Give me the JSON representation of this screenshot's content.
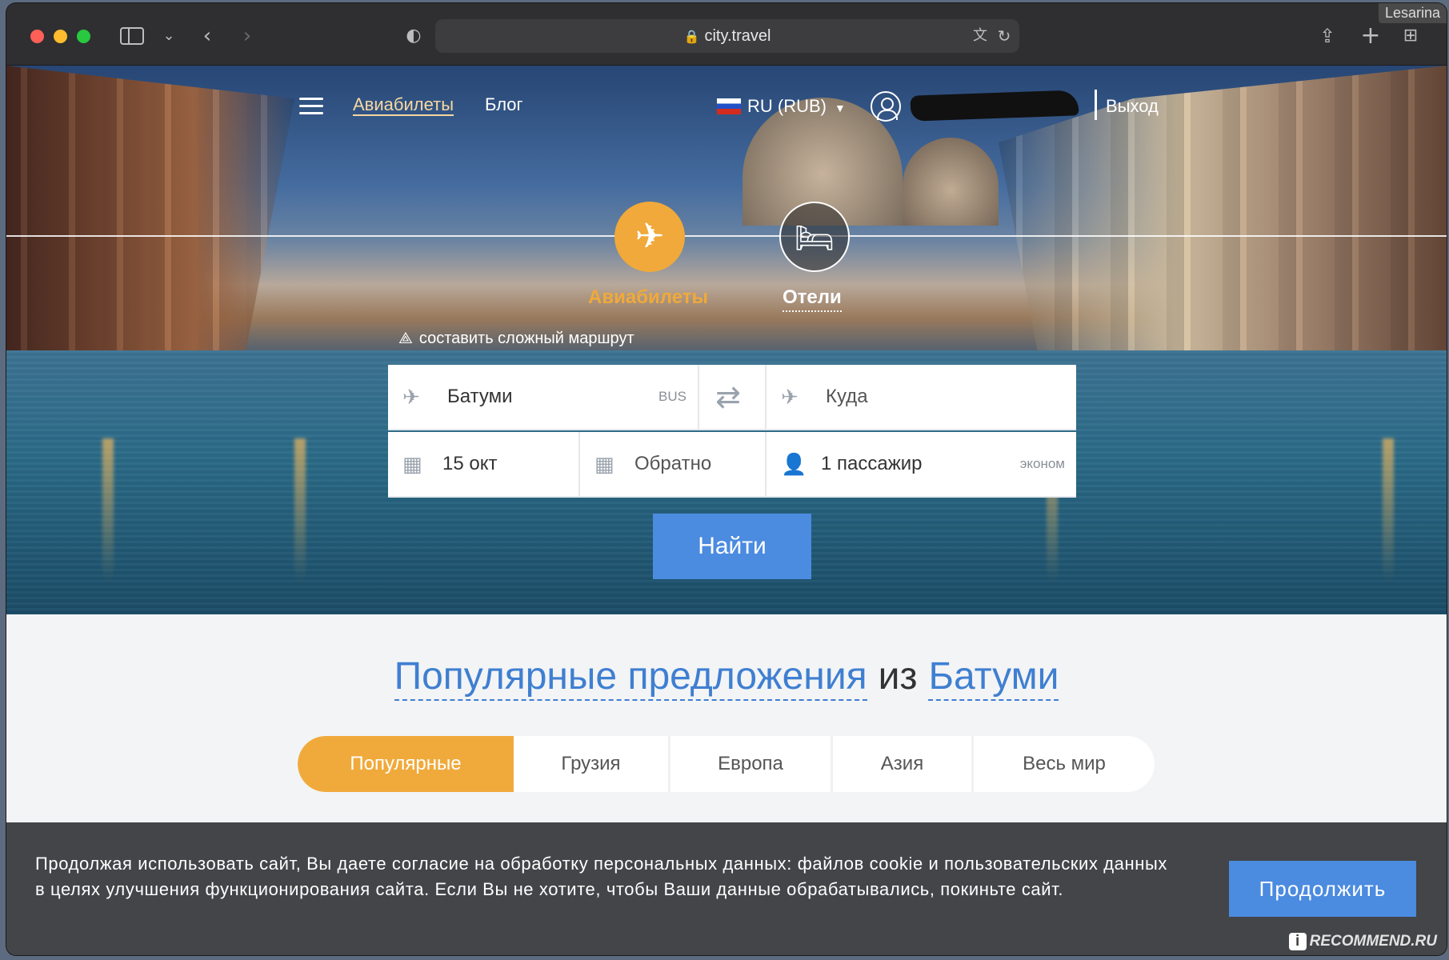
{
  "browser": {
    "url": "city.travel",
    "corner_badge": "Lesarina"
  },
  "nav": {
    "links": [
      "Авиабилеты",
      "Блог"
    ],
    "currency": "RU (RUB)",
    "logout": "Выход"
  },
  "modes": {
    "flights": "Авиабилеты",
    "hotels": "Отели"
  },
  "complex_route": "составить сложный маршрут",
  "search": {
    "from": "Батуми",
    "from_code": "BUS",
    "to_placeholder": "Куда",
    "date": "15 окт",
    "return_placeholder": "Обратно",
    "passengers": "1 пассажир",
    "class": "эконом",
    "button": "Найти"
  },
  "popular": {
    "title_part1": "Популярные предложения",
    "title_part2": "из",
    "title_city": "Батуми",
    "tabs": [
      "Популярные",
      "Грузия",
      "Европа",
      "Азия",
      "Весь мир"
    ],
    "active_tab": 0
  },
  "cookie": {
    "text": "Продолжая использовать сайт, Вы даете согласие на обработку персональных данных: файлов cookie и пользовательских данных в целях улучшения функционирования сайта. Если Вы не хотите, чтобы Ваши данные обрабатывались, покиньте сайт.",
    "button": "Продолжить"
  },
  "watermark": "RECOMMEND.RU",
  "colors": {
    "accent_orange": "#f0aa3c",
    "accent_blue": "#4b8be0",
    "link_blue": "#3f7fd1"
  }
}
